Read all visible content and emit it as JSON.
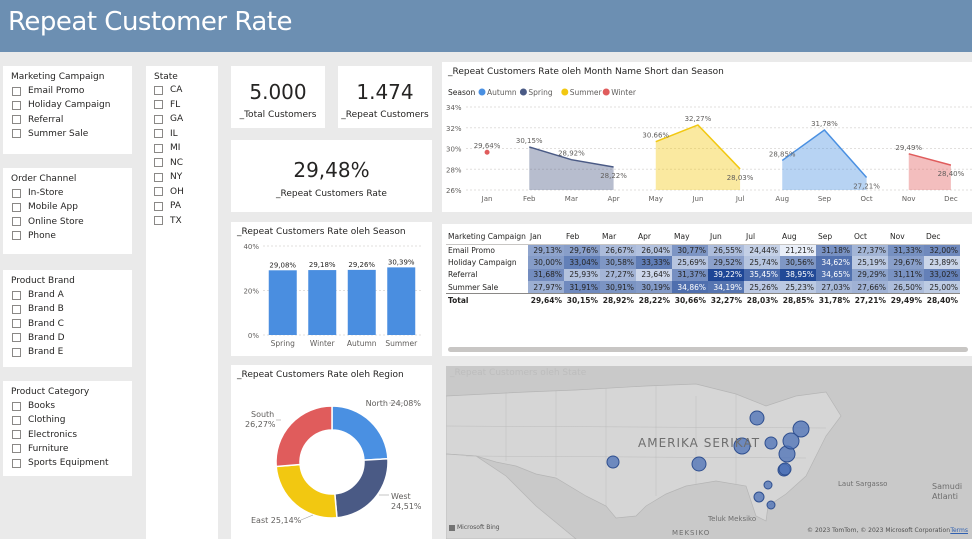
{
  "title": "Repeat Customer Rate",
  "slicers": {
    "campaign": {
      "title": "Marketing Campaign",
      "items": [
        "Email Promo",
        "Holiday Campaign",
        "Referral",
        "Summer Sale"
      ]
    },
    "channel": {
      "title": "Order Channel",
      "items": [
        "In-Store",
        "Mobile App",
        "Online Store",
        "Phone"
      ]
    },
    "brand": {
      "title": "Product Brand",
      "items": [
        "Brand A",
        "Brand B",
        "Brand C",
        "Brand D",
        "Brand E"
      ]
    },
    "category": {
      "title": "Product Category",
      "items": [
        "Books",
        "Clothing",
        "Electronics",
        "Furniture",
        "Sports Equipment"
      ]
    },
    "state": {
      "title": "State",
      "items": [
        "CA",
        "FL",
        "GA",
        "IL",
        "MI",
        "NC",
        "NY",
        "OH",
        "PA",
        "TX"
      ]
    }
  },
  "kpis": {
    "total_customers": {
      "value": "5.000",
      "label": "_Total Customers"
    },
    "repeat_customers": {
      "value": "1.474",
      "label": "_Repeat Customers"
    },
    "repeat_rate": {
      "value": "29,48%",
      "label": "_Repeat Customers Rate"
    }
  },
  "season_chart_title": "_Repeat Customers Rate oleh Season",
  "region_chart_title": "_Repeat Customers Rate oleh Region",
  "month_chart_title": "_Repeat Customers Rate oleh Month Name Short dan Season",
  "map": {
    "title": "_Repeat Customers oleh State",
    "labels": {
      "country": "AMERIKA SERIKAT",
      "gulf": "Teluk Meksiko",
      "sargasso": "Laut Sargasso",
      "atlantic_1": "Samudi",
      "atlantic_2": "Atlanti",
      "mexico": "MEKSIKO"
    },
    "bing": "Microsoft Bing",
    "copyright": "© 2023 TomTom, © 2023 Microsoft Corporation",
    "terms": "Terms"
  },
  "matrix": {
    "header": [
      "Marketing Campaign",
      "Jan",
      "Feb",
      "Mar",
      "Apr",
      "May",
      "Jun",
      "Jul",
      "Aug",
      "Sep",
      "Oct",
      "Nov",
      "Dec"
    ],
    "rows": [
      {
        "name": "Email Promo",
        "values": [
          "29,13%",
          "29,76%",
          "26,67%",
          "26,04%",
          "30,77%",
          "26,55%",
          "24,44%",
          "21,21%",
          "31,18%",
          "27,37%",
          "31,33%",
          "32,00%"
        ]
      },
      {
        "name": "Holiday Campaign",
        "values": [
          "30,00%",
          "33,04%",
          "30,58%",
          "33,33%",
          "25,69%",
          "29,52%",
          "25,74%",
          "30,56%",
          "34,62%",
          "25,19%",
          "29,67%",
          "23,89%"
        ]
      },
      {
        "name": "Referral",
        "values": [
          "31,68%",
          "25,93%",
          "27,27%",
          "23,64%",
          "31,37%",
          "39,22%",
          "35,45%",
          "38,95%",
          "34,65%",
          "29,29%",
          "31,11%",
          "33,02%"
        ]
      },
      {
        "name": "Summer Sale",
        "values": [
          "27,97%",
          "31,91%",
          "30,91%",
          "30,19%",
          "34,86%",
          "34,19%",
          "25,26%",
          "25,23%",
          "27,03%",
          "27,66%",
          "26,50%",
          "25,00%"
        ]
      }
    ],
    "total": {
      "name": "Total",
      "values": [
        "29,64%",
        "30,15%",
        "28,92%",
        "28,22%",
        "30,66%",
        "32,27%",
        "28,03%",
        "28,85%",
        "31,78%",
        "27,21%",
        "29,49%",
        "28,40%"
      ]
    }
  },
  "colors": {
    "header": "#6c8fb2",
    "autumn": "#4a90e2",
    "spring": "#4a5a85",
    "summer": "#f2c811",
    "winter": "#e05c5c",
    "bar": "#4a8ee0"
  },
  "chart_data": [
    {
      "type": "line",
      "title": "_Repeat Customers Rate oleh Month Name Short dan Season",
      "legend_title": "Season",
      "legend_position": "top-left",
      "categories": [
        "Jan",
        "Feb",
        "Mar",
        "Apr",
        "May",
        "Jun",
        "Jul",
        "Aug",
        "Sep",
        "Oct",
        "Nov",
        "Dec"
      ],
      "ylim": [
        26,
        34
      ],
      "yticks": [
        "26%",
        "28%",
        "30%",
        "32%",
        "34%"
      ],
      "series": [
        {
          "name": "Autumn",
          "color": "#4a90e2",
          "x": [
            "Aug",
            "Sep",
            "Oct"
          ],
          "values": [
            28.85,
            31.78,
            27.21
          ],
          "labels": [
            "28,85%",
            "31,78%",
            "27,21%"
          ]
        },
        {
          "name": "Spring",
          "color": "#4a5a85",
          "x": [
            "Feb",
            "Mar",
            "Apr"
          ],
          "values": [
            30.15,
            28.92,
            28.22
          ],
          "labels": [
            "30,15%",
            "28,92%",
            "28,22%"
          ]
        },
        {
          "name": "Summer",
          "color": "#f2c811",
          "x": [
            "May",
            "Jun",
            "Jul"
          ],
          "values": [
            30.66,
            32.27,
            28.03
          ],
          "labels": [
            "30.66%",
            "32,27%",
            "28,03%"
          ]
        },
        {
          "name": "Winter",
          "color": "#e05c5c",
          "x": [
            "Jan",
            "Nov",
            "Dec"
          ],
          "values": [
            29.64,
            29.49,
            28.4
          ],
          "labels": [
            "29,64%",
            "29,49%",
            "28,40%"
          ]
        }
      ]
    },
    {
      "type": "bar",
      "title": "_Repeat Customers Rate oleh Season",
      "categories": [
        "Spring",
        "Winter",
        "Autumn",
        "Summer"
      ],
      "values": [
        29.08,
        29.18,
        29.26,
        30.39
      ],
      "labels": [
        "29,08%",
        "29,18%",
        "29,26%",
        "30,39%"
      ],
      "ylim": [
        0,
        40
      ],
      "yticks": [
        "0%",
        "20%",
        "40%"
      ]
    },
    {
      "type": "pie",
      "title": "_Repeat Customers Rate oleh Region",
      "categories": [
        "North",
        "West",
        "East",
        "South"
      ],
      "values": [
        24.08,
        24.51,
        25.14,
        26.27
      ],
      "labels": [
        "North 24,08%",
        "West 24,51%",
        "East 25,14%",
        "South 26,27%"
      ],
      "colors": [
        "#4a90e2",
        "#4a5a85",
        "#f2c811",
        "#e05c5c"
      ]
    }
  ]
}
